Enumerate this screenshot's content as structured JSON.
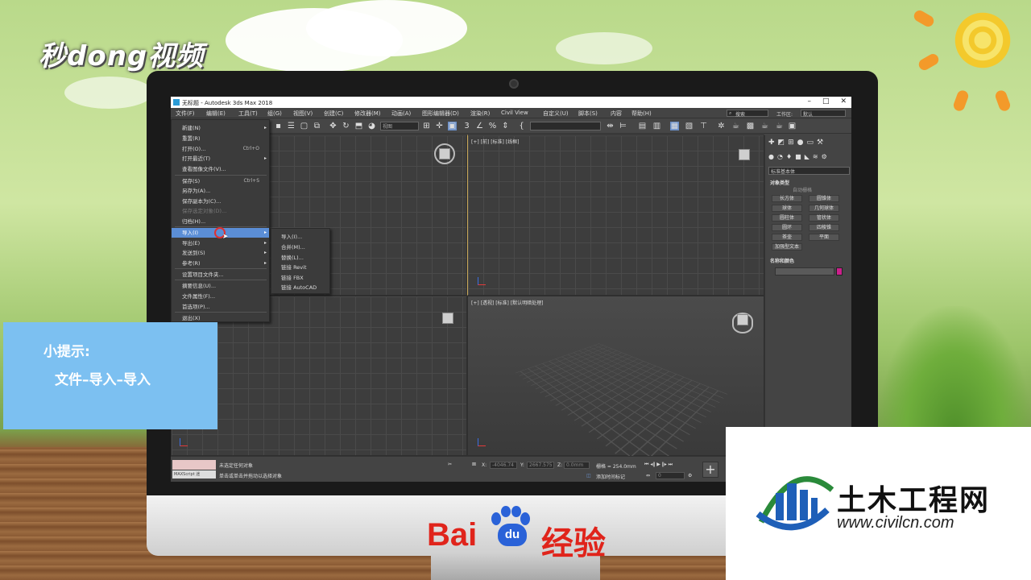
{
  "brand": {
    "logo_text": "秒dong视频"
  },
  "window": {
    "title": "无标题 - Autodesk 3ds Max 2018",
    "controls": [
      "–",
      "□",
      "✕"
    ]
  },
  "menubar": {
    "items": [
      "文件(F)",
      "编辑(E)",
      "工具(T)",
      "组(G)",
      "视图(V)",
      "创建(C)",
      "修改器(M)",
      "动画(A)",
      "图形编辑器(D)",
      "渲染(R)",
      "Civil View",
      "自定义(U)",
      "脚本(S)",
      "内容",
      "帮助(H)"
    ],
    "search_value": "搜索",
    "workspace_label": "工作区:",
    "workspace_value": "默认"
  },
  "toolbar": {
    "view_dropdown": "视图"
  },
  "file_menu": {
    "items": [
      {
        "label": "新建(N)",
        "shortcut": "",
        "submenu": true,
        "state": "normal"
      },
      {
        "label": "重置(R)",
        "shortcut": "",
        "submenu": false,
        "state": "normal"
      },
      {
        "label": "打开(O)...",
        "shortcut": "Ctrl+O",
        "submenu": false,
        "state": "normal"
      },
      {
        "label": "打开最近(T)",
        "shortcut": "",
        "submenu": true,
        "state": "normal"
      },
      {
        "label": "查看图像文件(V)...",
        "shortcut": "",
        "submenu": false,
        "state": "normal"
      },
      {
        "label": "保存(S)",
        "shortcut": "Ctrl+S",
        "submenu": false,
        "state": "normal"
      },
      {
        "label": "另存为(A)...",
        "shortcut": "",
        "submenu": false,
        "state": "normal"
      },
      {
        "label": "保存副本为(C)...",
        "shortcut": "",
        "submenu": false,
        "state": "normal"
      },
      {
        "label": "保存选定对象(D)...",
        "shortcut": "",
        "submenu": false,
        "state": "disabled"
      },
      {
        "label": "归档(H)...",
        "shortcut": "",
        "submenu": false,
        "state": "normal"
      },
      {
        "label": "导入(I)",
        "shortcut": "",
        "submenu": true,
        "state": "active"
      },
      {
        "label": "导出(E)",
        "shortcut": "",
        "submenu": true,
        "state": "normal"
      },
      {
        "label": "发送到(S)",
        "shortcut": "",
        "submenu": true,
        "state": "normal"
      },
      {
        "label": "参考(R)",
        "shortcut": "",
        "submenu": true,
        "state": "normal"
      },
      {
        "label": "设置项目文件夹...",
        "shortcut": "",
        "submenu": false,
        "state": "normal"
      },
      {
        "label": "摘要信息(U)...",
        "shortcut": "",
        "submenu": false,
        "state": "normal"
      },
      {
        "label": "文件属性(F)...",
        "shortcut": "",
        "submenu": false,
        "state": "normal"
      },
      {
        "label": "首选项(P)...",
        "shortcut": "",
        "submenu": false,
        "state": "normal"
      },
      {
        "label": "退出(X)",
        "shortcut": "",
        "submenu": false,
        "state": "normal"
      }
    ]
  },
  "import_submenu": {
    "items": [
      "导入(I)...",
      "合并(M)...",
      "替换(L)...",
      "链接 Revit",
      "链接 FBX",
      "链接 AutoCAD"
    ]
  },
  "viewports": {
    "top_right": "[+] [前] [标准] [线框]",
    "bottom_right": "[+] [透视] [标准] [默认明暗处理]"
  },
  "command_panel": {
    "category": "标准基本体",
    "rollout_object_type": "对象类型",
    "auto_grid": "自动栅格",
    "object_buttons": [
      "长方体",
      "圆锥体",
      "球体",
      "几何球体",
      "圆柱体",
      "管状体",
      "圆环",
      "四棱锥",
      "茶壶",
      "平面",
      "加强型文本"
    ],
    "rollout_name_color": "名称和颜色",
    "color": "#cc1f8c"
  },
  "status_bar": {
    "maxscript": "MAXScript 迷",
    "line1": "未选定任何对象",
    "line2": "单击或单击并拖动以选择对象",
    "x_label": "X:",
    "x_value": "-4046.74",
    "y_label": "Y:",
    "y_value": "2667.575",
    "z_label": "Z:",
    "z_value": "0.0mm",
    "grid": "栅格 = 254.0mm",
    "add_time_tag": "添加时间标记",
    "frame_value": "0"
  },
  "tip": {
    "title": "小提示:",
    "body": "文件–导入–导入"
  },
  "baidu": {
    "left": "Bai",
    "du": "du",
    "right": "经验"
  },
  "civilcn": {
    "name": "土木工程网",
    "url": "www.civilcn.com"
  }
}
